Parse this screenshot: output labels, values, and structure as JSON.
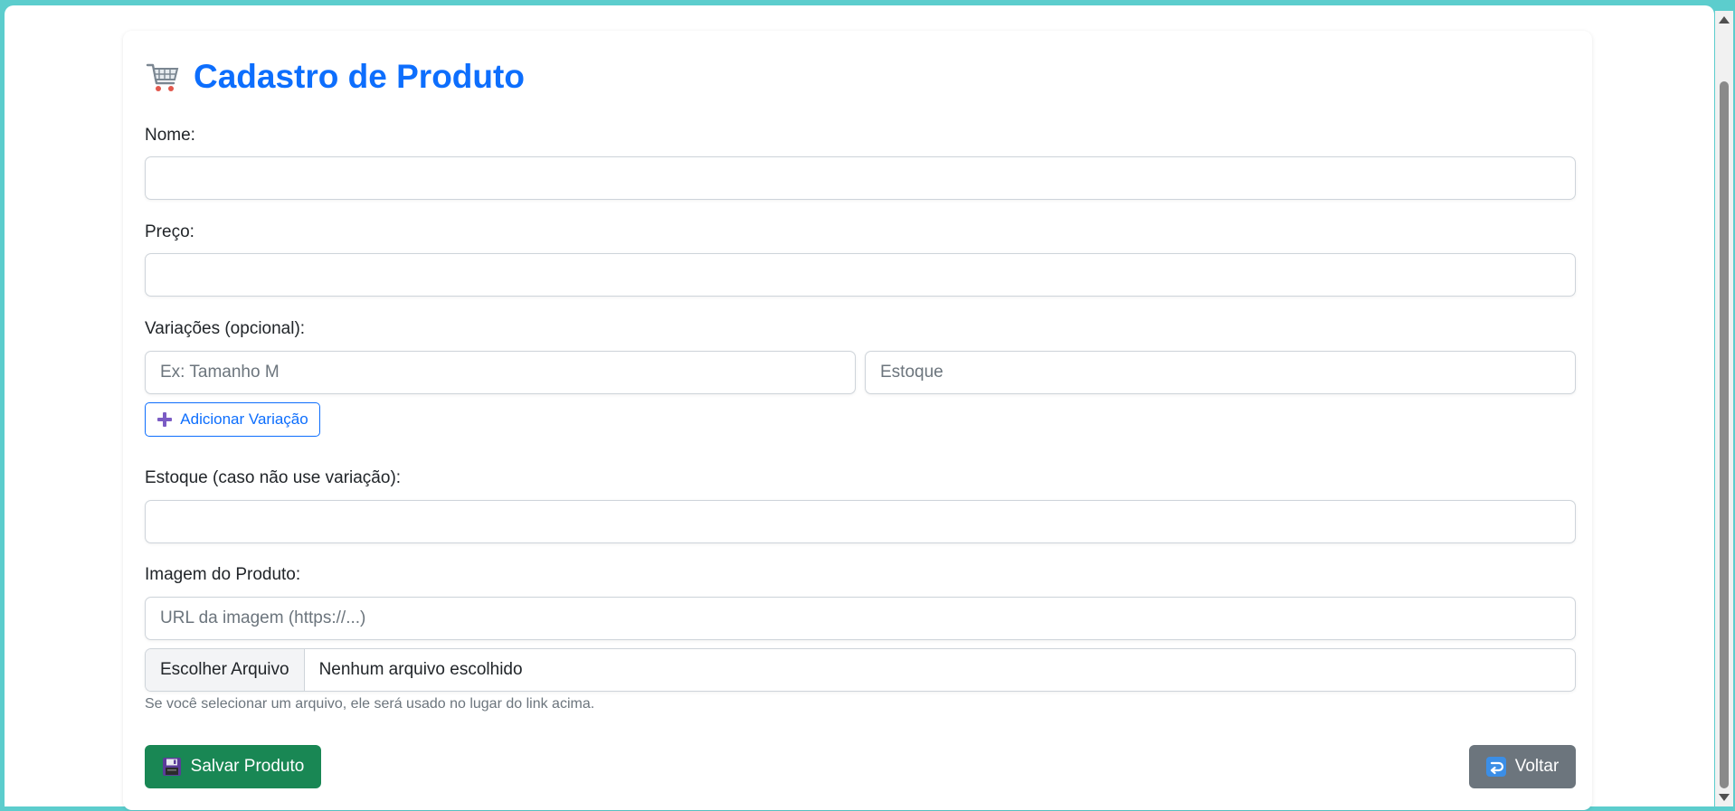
{
  "title": "Cadastro de Produto",
  "fields": {
    "nome": {
      "label": "Nome:",
      "value": ""
    },
    "preco": {
      "label": "Preço:",
      "value": ""
    },
    "variacoes": {
      "label": "Variações (opcional):",
      "name_placeholder": "Ex: Tamanho M",
      "stock_placeholder": "Estoque",
      "add_button_label": "Adicionar Variação"
    },
    "estoque": {
      "label": "Estoque (caso não use variação):",
      "value": ""
    },
    "imagem": {
      "label": "Imagem do Produto:",
      "url_placeholder": "URL da imagem (https://...)",
      "file_button_label": "Escolher Arquivo",
      "file_status": "Nenhum arquivo escolhido",
      "help_text": "Se você selecionar um arquivo, ele será usado no lugar do link acima."
    }
  },
  "actions": {
    "save_label": "Salvar Produto",
    "back_label": "Voltar"
  },
  "icons": {
    "title_icon": "shopping-cart-icon",
    "add_icon": "plus-icon",
    "save_icon": "floppy-disk-icon",
    "back_icon": "return-arrow-icon"
  },
  "colors": {
    "primary": "#0d6efd",
    "success": "#198754",
    "secondary": "#6c757d",
    "frame": "#5ccdcd"
  }
}
